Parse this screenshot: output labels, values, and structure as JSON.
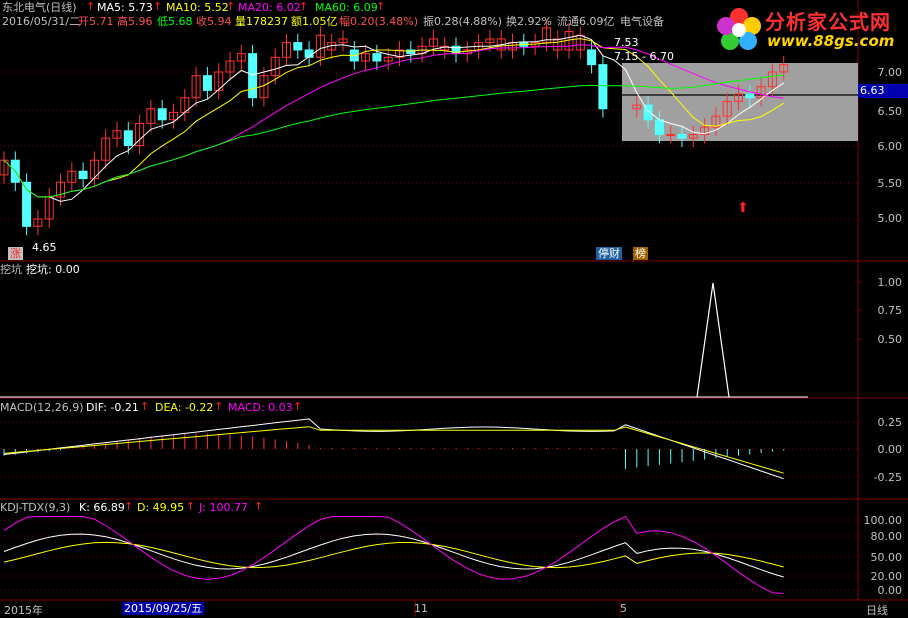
{
  "header": {
    "stock": "东北电气(日线)",
    "ma5_label": "MA5: 5.73",
    "ma10_label": "MA10: 5.52",
    "ma20_label": "MA20: 6.02",
    "ma60_label": "MA60: 6.09",
    "date": "2016/05/31/二",
    "open": "开5.71",
    "high": "高5.96",
    "low": "低5.68",
    "close": "收5.94",
    "volume": "量178237",
    "amount": "额1.05亿",
    "change": "幅0.20(3.48%)",
    "amplitude": "振0.28(4.88%)",
    "turnover": "换2.92%",
    "float_cap": "流通6.09亿",
    "industry": "电气设备"
  },
  "logo": {
    "title": "分析家公式网",
    "url": "www.88gs.com"
  },
  "main_panel": {
    "y_ticks": [
      "7.00",
      "6.50",
      "6.00",
      "5.50",
      "5.00"
    ],
    "current_price": "6.63",
    "high_marker": "7.53",
    "box_label": "7.15 - 6.70",
    "low_marker": "4.65",
    "tag_zhang": "涨",
    "tag_tingcai": "停财",
    "tag_bang": "榜"
  },
  "ind1": {
    "name": "挖坑",
    "value_label": "挖坑: 0.00",
    "y_ticks": [
      "1.00",
      "0.75",
      "0.50"
    ]
  },
  "macd": {
    "name": "MACD(12,26,9)",
    "dif": "DIF: -0.21",
    "dea": "DEA: -0.22",
    "macd": "MACD: 0.03",
    "y_ticks": [
      "0.25",
      "0.00",
      "-0.25"
    ]
  },
  "kdj": {
    "name": "KDJ-TDX(9,3)",
    "k": "K: 66.89",
    "d": "D: 49.95",
    "j": "J: 100.77",
    "y_ticks": [
      "100.00",
      "80.00",
      "50.00",
      "20.00",
      "0.00"
    ]
  },
  "xaxis": {
    "year": "2015年",
    "cursor_date": "2015/09/25/五",
    "m11": "11",
    "m5": "5",
    "period": "日线"
  },
  "colors": {
    "up": "#ff3232",
    "down": "#54ffff",
    "ma5": "#ffffff",
    "ma10": "#ffff00",
    "ma20": "#ff00ff",
    "ma60": "#00ff00",
    "grid": "#800000"
  }
}
